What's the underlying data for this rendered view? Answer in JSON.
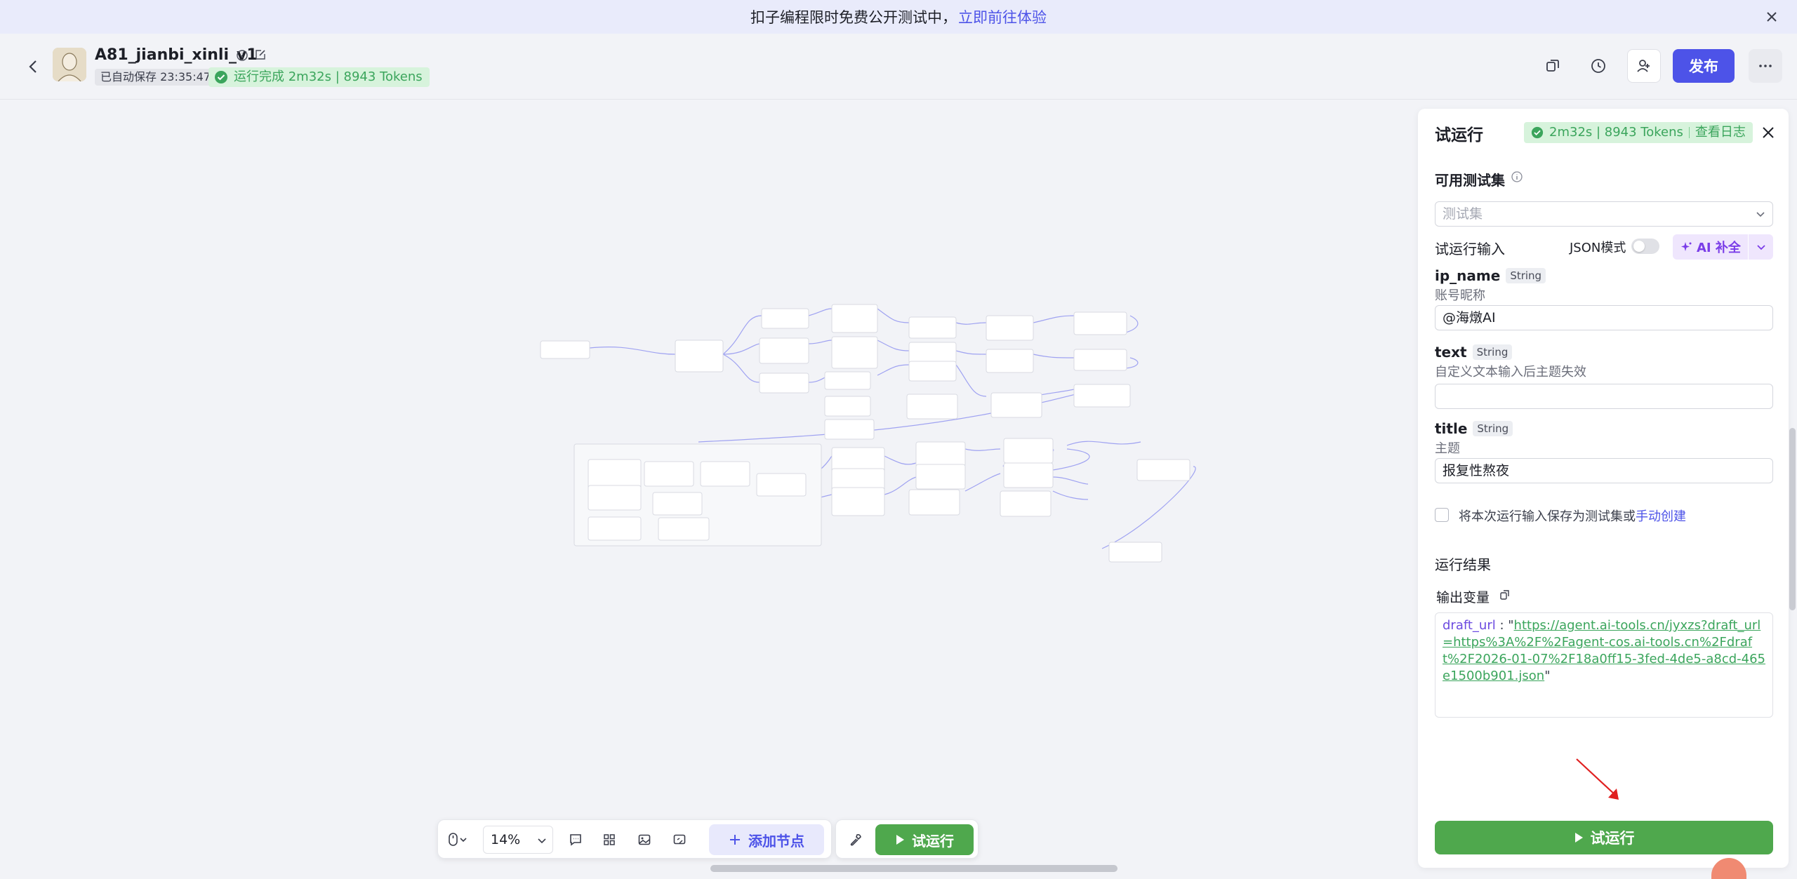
{
  "banner": {
    "text": "扣子编程限时免费公开测试中，",
    "link": "立即前往体验"
  },
  "header": {
    "app_name": "A81_jianbi_xinli_v1",
    "autosave": "已自动保存 23:35:47",
    "run_status": "运行完成 2m32s | 8943 Tokens",
    "publish_label": "发布"
  },
  "panel": {
    "title": "试运行",
    "badge_stats": "2m32s | 8943 Tokens",
    "badge_log": "查看日志",
    "testset_label": "可用测试集",
    "testset_placeholder": "测试集",
    "input_label": "试运行输入",
    "json_mode_label": "JSON模式",
    "ai_button": "AI 补全",
    "fields": [
      {
        "name": "ip_name",
        "type": "String",
        "desc": "账号昵称",
        "value": "@海燉AI"
      },
      {
        "name": "text",
        "type": "String",
        "desc": "自定义文本输入后主题失效",
        "value": ""
      },
      {
        "name": "title",
        "type": "String",
        "desc": "主题",
        "value": "报复性熬夜"
      }
    ],
    "save_text": "将本次运行输入保存为测试集或",
    "save_link": "手动创建",
    "result_title": "运行结果",
    "output_label": "输出变量",
    "output_key": "draft_url",
    "output_value": "https://agent.ai-tools.cn/jyxzs?draft_url=https%3A%2F%2Fagent-cos.ai-tools.cn%2Fdraft%2F2026-01-07%2F18a0ff15-3fed-4de5-a8cd-465e1500b901.json",
    "run_button": "试运行"
  },
  "toolbar": {
    "zoom": "14%",
    "add_node": "添加节点",
    "trial_run": "试运行"
  }
}
